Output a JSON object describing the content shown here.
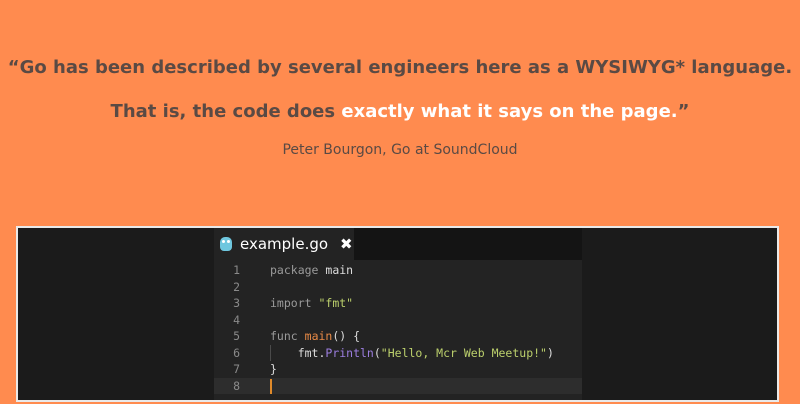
{
  "quote": {
    "line1": "“Go has been described by several engineers here as a WYSIWYG* language.",
    "line2_plain": "That is, the code does ",
    "line2_highlight": "exactly what it says on the page.",
    "line2_close": "”"
  },
  "attribution": "Peter Bourgon, Go at SoundCloud",
  "colors": {
    "background": "#ff8b4f",
    "quote_text": "#5a4a44",
    "highlight": "#ffffff",
    "editor_bg": "#232323"
  },
  "editor": {
    "tab": {
      "icon": "gopher-icon",
      "filename": "example.go",
      "close_glyph": "✖"
    },
    "lines": [
      {
        "n": "1",
        "tokens": [
          {
            "t": "package",
            "c": "kw"
          },
          {
            "t": " main",
            "c": ""
          }
        ]
      },
      {
        "n": "2",
        "tokens": []
      },
      {
        "n": "3",
        "tokens": [
          {
            "t": "import",
            "c": "kw"
          },
          {
            "t": " ",
            "c": ""
          },
          {
            "t": "\"fmt\"",
            "c": "str"
          }
        ]
      },
      {
        "n": "4",
        "tokens": []
      },
      {
        "n": "5",
        "tokens": [
          {
            "t": "func",
            "c": "kw"
          },
          {
            "t": " ",
            "c": ""
          },
          {
            "t": "main",
            "c": "fn"
          },
          {
            "t": "() {",
            "c": ""
          }
        ]
      },
      {
        "n": "6",
        "tokens": [
          {
            "t": "    fmt.",
            "c": ""
          },
          {
            "t": "Println",
            "c": "meth"
          },
          {
            "t": "(",
            "c": ""
          },
          {
            "t": "\"Hello, Mcr Web Meetup!\"",
            "c": "str"
          },
          {
            "t": ")",
            "c": ""
          }
        ],
        "guide": true
      },
      {
        "n": "7",
        "tokens": [
          {
            "t": "}",
            "c": ""
          }
        ]
      },
      {
        "n": "8",
        "tokens": [],
        "active": true,
        "cursor": true
      }
    ]
  }
}
